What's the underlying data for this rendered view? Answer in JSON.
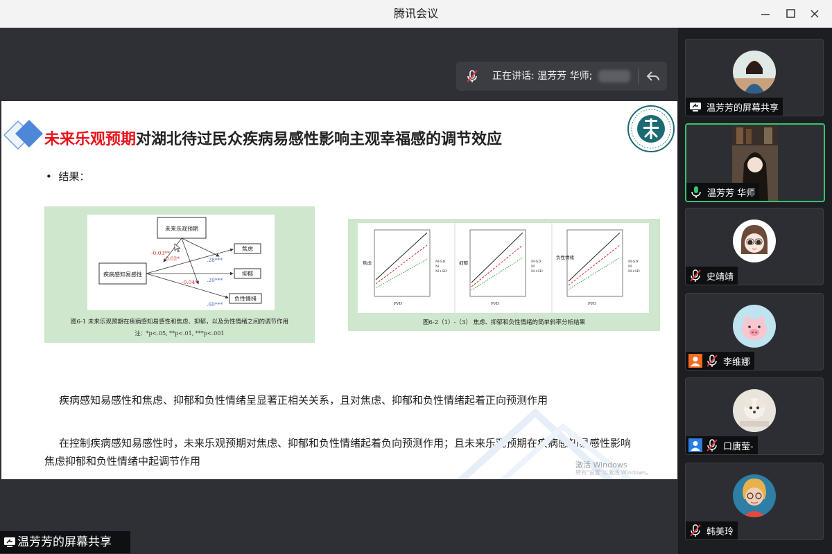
{
  "window": {
    "title": "腾讯会议"
  },
  "speaking": {
    "text": "正在讲话: 温芳芳 华师;"
  },
  "slide": {
    "title_highlight": "未来乐观预期",
    "title_rest": "对湖北待过民众疾病易感性影响主观幸福感的调节效应",
    "bullet": "结果：",
    "figure1": {
      "nodes": {
        "top": "未来乐观预期",
        "left": "疾病感知易感性",
        "out1": "焦虑",
        "out2": "抑郁",
        "out3": "负性情绪"
      },
      "coefs": {
        "c1": "-0.03**",
        "c2": "-0.02*",
        "c3": "-0.04*",
        "b1": ".28***",
        "b2": ".20***",
        "b3": ".60***"
      },
      "caption": "图6-1  未来乐观预期在疾病感知易感性和焦虑、抑郁，以及负性情绪之间的调节作用",
      "note": "注：*p<.05, **p<.01, ***p<.001"
    },
    "figure2": {
      "caption": "图6-2（1）-（3）  焦虑、抑郁和负性情绪的简单斜率分析结果",
      "xlabel": "PVD",
      "ylabels": [
        "焦虑",
        "抑郁",
        "负性情绪"
      ],
      "legend": [
        "M-SD",
        "M",
        "M+SD"
      ]
    },
    "para1": "疾病感知易感性和焦虑、抑郁和负性情绪呈显著正相关关系，且对焦虑、抑郁和负性情绪起着正向预测作用",
    "para2": "在控制疾病感知易感性时，未来乐观预期对焦虑、抑郁和负性情绪起着负向预测作用；且未来乐观预期在疾病感知易感性影响焦虑抑郁和负性情绪中起调节作用",
    "watermark1": "激活 Windows",
    "watermark2": "转到\"设置\"以激活 Windows。"
  },
  "share_label": "温芳芳的屏幕共享",
  "participants": [
    {
      "name": "温芳芳的屏幕共享",
      "icon": "screen-share-icon"
    },
    {
      "name": "温芳芳 华师",
      "icon": "mic-on-icon",
      "active": true
    },
    {
      "name": "史靖靖",
      "icon": "mic-muted-icon"
    },
    {
      "name": "李维娜",
      "icon": "mic-muted-icon",
      "badge": "user-badge-icon"
    },
    {
      "name": "口唐莹-",
      "icon": "mic-muted-icon",
      "badge": "user-badge-icon"
    },
    {
      "name": "韩美玲",
      "icon": "mic-muted-icon"
    }
  ],
  "colors": {
    "accent_green": "#35c46c",
    "title_red": "#e8141b",
    "badge_orange": "#f26b21",
    "badge_blue": "#2a7de1"
  }
}
